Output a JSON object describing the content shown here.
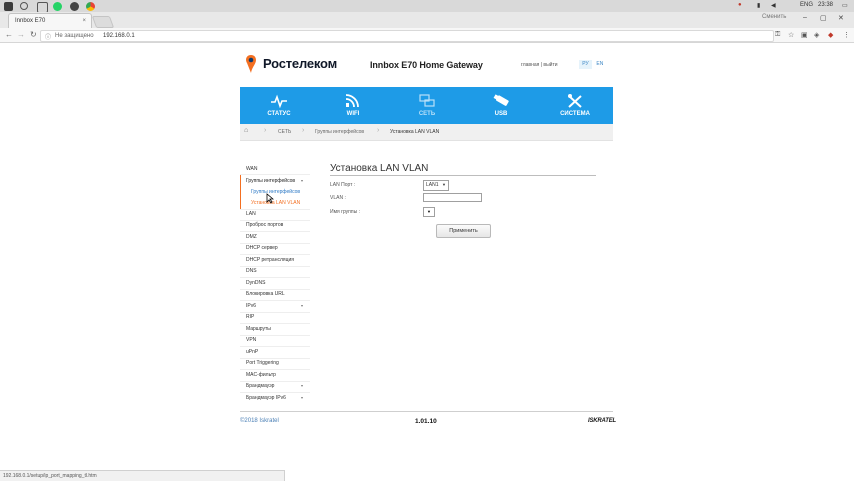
{
  "taskbar": {
    "tray": {
      "lang": "ENG",
      "time": "23:38"
    },
    "colors": {
      "whatsapp": "#25d366",
      "chrome": "#4285f4",
      "accent": "#2b78c5"
    }
  },
  "browser": {
    "tab_title": "Innbox E70",
    "tab_close": "×",
    "profile": "Сменить",
    "window_controls": {
      "minimize": "–",
      "maximize": "▢",
      "close": "✕"
    },
    "nav": {
      "back": "←",
      "forward": "→",
      "reload": "↻"
    },
    "security_label": "Не защищено",
    "url": "192.168.0.1",
    "status_url": "192.168.0.1/setup/ip_port_mapping_tl.htm"
  },
  "header": {
    "brand": "Ростелеком",
    "product": "Innbox E70 Home Gateway",
    "links": {
      "home": "главная",
      "sep": "|",
      "logout": "выйти"
    },
    "lang_ru": "РУ",
    "lang_en": "EN",
    "brand_color": "#0b3a6e",
    "logo_color": "#f36f21"
  },
  "topnav": {
    "bg": "#1e9be7",
    "items": [
      {
        "label": "СТАТУС",
        "icon": "pulse-icon"
      },
      {
        "label": "WIFI",
        "icon": "wifi-icon"
      },
      {
        "label": "СЕТЬ",
        "icon": "network-icon"
      },
      {
        "label": "USB",
        "icon": "usb-icon"
      },
      {
        "label": "СИСТЕМА",
        "icon": "tools-icon"
      }
    ]
  },
  "breadcrumb": {
    "home_icon": "home-icon",
    "items": [
      "СЕТЬ",
      "Группы интерфейсов",
      "Установка LAN VLAN"
    ]
  },
  "sidebar": {
    "items": [
      {
        "label": "WAN"
      },
      {
        "label": "Группы интерфейсов",
        "expanded": true,
        "caret": "▾"
      },
      {
        "label": "Группы интерфейсов",
        "sub": true
      },
      {
        "label": "Установка LAN VLAN",
        "sub": true,
        "active": true
      },
      {
        "label": "LAN"
      },
      {
        "label": "Проброс портов"
      },
      {
        "label": "DMZ"
      },
      {
        "label": "DHCP сервер"
      },
      {
        "label": "DHCP ретрансляция"
      },
      {
        "label": "DNS"
      },
      {
        "label": "DynDNS"
      },
      {
        "label": "Блокировка URL"
      },
      {
        "label": "IPv6",
        "caret": "▾"
      },
      {
        "label": "RIP"
      },
      {
        "label": "Маршруты"
      },
      {
        "label": "VPN"
      },
      {
        "label": "uPnP"
      },
      {
        "label": "Port Triggering"
      },
      {
        "label": "MAC-фильтр"
      },
      {
        "label": "Брандмауэр",
        "caret": "▾"
      },
      {
        "label": "Брандмауэр IPv6",
        "caret": "▾"
      }
    ],
    "active_color": "#f36f21"
  },
  "form": {
    "title": "Установка LAN VLAN",
    "lan_port_label": "LAN Порт :",
    "lan_port_value": "LAN1",
    "vlan_label": "VLAN :",
    "vlan_value": "",
    "group_label": "Имя группы :",
    "group_value": "",
    "apply_label": "Применить"
  },
  "footer": {
    "copyright": "©2018 Iskratel",
    "version": "1.01.10",
    "vendor": "ISKRATEL"
  }
}
